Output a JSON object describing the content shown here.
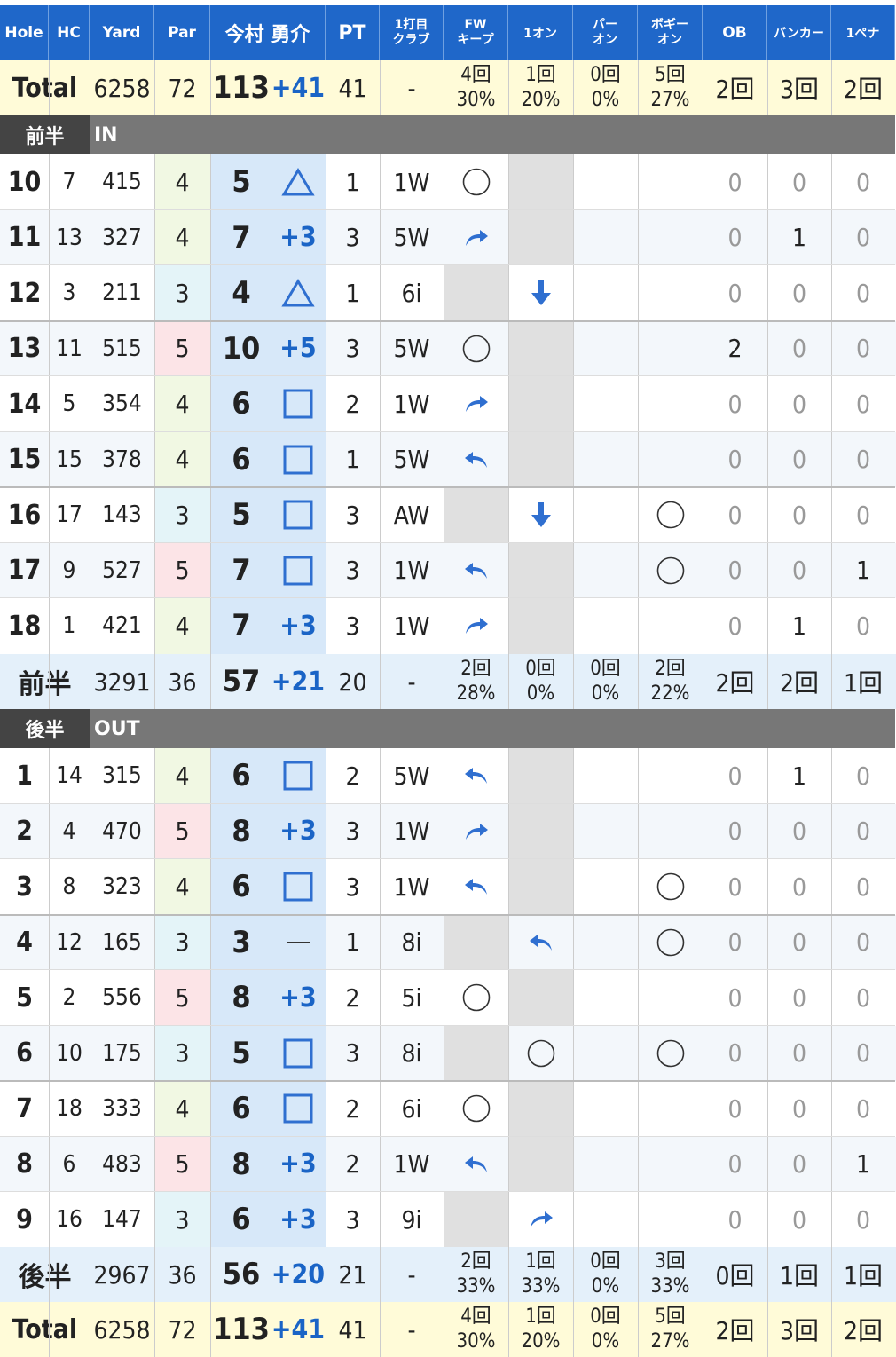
{
  "headers": {
    "hole": "Hole",
    "hc": "HC",
    "yard": "Yard",
    "par": "Par",
    "player": "今村 勇介",
    "pt": "PT",
    "club1": "1打目",
    "club2": "クラブ",
    "fw1": "FW",
    "fw2": "キープ",
    "oneon": "1オン",
    "paron1": "パー",
    "paron2": "オン",
    "bogey1": "ボギー",
    "bogey2": "オン",
    "ob": "OB",
    "bunker": "バンカー",
    "penalty": "1ペナ"
  },
  "sections": {
    "front_label": "前半",
    "front_course": "IN",
    "back_label": "後半",
    "back_course": "OUT"
  },
  "colors": {
    "header_bg": "#1f67c9",
    "score_bg": "#d7e8f9",
    "total_bg": "#fffbd8",
    "subtotal_bg": "#e4f0fa",
    "section_bg": "#777777",
    "par3": "#e4f4f8",
    "par4": "#f1f8e3",
    "par5": "#fce4e7",
    "accent_blue": "#1a64c6",
    "shaded": "#e0e0e0"
  },
  "total_top": {
    "label": "Total",
    "yard": "6258",
    "par": "72",
    "score": "113",
    "rel": "+41",
    "pt": "41",
    "club": "-",
    "fw": [
      "4回",
      "30%"
    ],
    "oneon": [
      "1回",
      "20%"
    ],
    "paron": [
      "0回",
      "0%"
    ],
    "bogey": [
      "5回",
      "27%"
    ],
    "ob": "2回",
    "bunker": "3回",
    "penalty": "2回"
  },
  "front": [
    {
      "hole": "10",
      "hc": "7",
      "yard": "415",
      "par": "4",
      "score": "5",
      "rel": "△",
      "relkind": "triangle",
      "pt": "1",
      "club": "1W",
      "fw": "circle",
      "oneon": "shade",
      "paron": "",
      "bogey": "",
      "ob": "0",
      "bunker": "0",
      "penalty": "0"
    },
    {
      "hole": "11",
      "hc": "13",
      "yard": "327",
      "par": "4",
      "score": "7",
      "rel": "+3",
      "relkind": "text",
      "pt": "3",
      "club": "5W",
      "fw": "right-arrow-icon",
      "oneon": "shade",
      "paron": "",
      "bogey": "",
      "ob": "0",
      "bunker": "1",
      "penalty": "0"
    },
    {
      "hole": "12",
      "hc": "3",
      "yard": "211",
      "par": "3",
      "score": "4",
      "rel": "△",
      "relkind": "triangle",
      "pt": "1",
      "club": "6i",
      "fw": "shade",
      "oneon": "down-arrow-icon",
      "paron": "",
      "bogey": "",
      "ob": "0",
      "bunker": "0",
      "penalty": "0"
    },
    {
      "hole": "13",
      "hc": "11",
      "yard": "515",
      "par": "5",
      "score": "10",
      "rel": "+5",
      "relkind": "text",
      "pt": "3",
      "club": "5W",
      "fw": "circle",
      "oneon": "shade",
      "paron": "",
      "bogey": "",
      "ob": "2",
      "bunker": "0",
      "penalty": "0"
    },
    {
      "hole": "14",
      "hc": "5",
      "yard": "354",
      "par": "4",
      "score": "6",
      "rel": "□",
      "relkind": "square",
      "pt": "2",
      "club": "1W",
      "fw": "right-arrow-icon",
      "oneon": "shade",
      "paron": "",
      "bogey": "",
      "ob": "0",
      "bunker": "0",
      "penalty": "0"
    },
    {
      "hole": "15",
      "hc": "15",
      "yard": "378",
      "par": "4",
      "score": "6",
      "rel": "□",
      "relkind": "square",
      "pt": "1",
      "club": "5W",
      "fw": "left-arrow-icon",
      "oneon": "shade",
      "paron": "",
      "bogey": "",
      "ob": "0",
      "bunker": "0",
      "penalty": "0"
    },
    {
      "hole": "16",
      "hc": "17",
      "yard": "143",
      "par": "3",
      "score": "5",
      "rel": "□",
      "relkind": "square",
      "pt": "3",
      "club": "AW",
      "fw": "shade",
      "oneon": "down-arrow-icon",
      "paron": "",
      "bogey": "circle",
      "ob": "0",
      "bunker": "0",
      "penalty": "0"
    },
    {
      "hole": "17",
      "hc": "9",
      "yard": "527",
      "par": "5",
      "score": "7",
      "rel": "□",
      "relkind": "square",
      "pt": "3",
      "club": "1W",
      "fw": "left-arrow-icon",
      "oneon": "shade",
      "paron": "",
      "bogey": "circle",
      "ob": "0",
      "bunker": "0",
      "penalty": "1"
    },
    {
      "hole": "18",
      "hc": "1",
      "yard": "421",
      "par": "4",
      "score": "7",
      "rel": "+3",
      "relkind": "text",
      "pt": "3",
      "club": "1W",
      "fw": "right-arrow-icon",
      "oneon": "shade",
      "paron": "",
      "bogey": "",
      "ob": "0",
      "bunker": "1",
      "penalty": "0"
    }
  ],
  "front_total": {
    "label": "前半",
    "yard": "3291",
    "par": "36",
    "score": "57",
    "rel": "+21",
    "pt": "20",
    "club": "-",
    "fw": [
      "2回",
      "28%"
    ],
    "oneon": [
      "0回",
      "0%"
    ],
    "paron": [
      "0回",
      "0%"
    ],
    "bogey": [
      "2回",
      "22%"
    ],
    "ob": "2回",
    "bunker": "2回",
    "penalty": "1回"
  },
  "back": [
    {
      "hole": "1",
      "hc": "14",
      "yard": "315",
      "par": "4",
      "score": "6",
      "rel": "□",
      "relkind": "square",
      "pt": "2",
      "club": "5W",
      "fw": "left-arrow-icon",
      "oneon": "shade",
      "paron": "",
      "bogey": "",
      "ob": "0",
      "bunker": "1",
      "penalty": "0"
    },
    {
      "hole": "2",
      "hc": "4",
      "yard": "470",
      "par": "5",
      "score": "8",
      "rel": "+3",
      "relkind": "text",
      "pt": "3",
      "club": "1W",
      "fw": "right-arrow-icon",
      "oneon": "shade",
      "paron": "",
      "bogey": "",
      "ob": "0",
      "bunker": "0",
      "penalty": "0"
    },
    {
      "hole": "3",
      "hc": "8",
      "yard": "323",
      "par": "4",
      "score": "6",
      "rel": "□",
      "relkind": "square",
      "pt": "3",
      "club": "1W",
      "fw": "left-arrow-icon",
      "oneon": "shade",
      "paron": "",
      "bogey": "circle",
      "ob": "0",
      "bunker": "0",
      "penalty": "0"
    },
    {
      "hole": "4",
      "hc": "12",
      "yard": "165",
      "par": "3",
      "score": "3",
      "rel": "—",
      "relkind": "dash",
      "pt": "1",
      "club": "8i",
      "fw": "shade",
      "oneon": "left-arrow-icon",
      "paron": "",
      "bogey": "circle",
      "ob": "0",
      "bunker": "0",
      "penalty": "0"
    },
    {
      "hole": "5",
      "hc": "2",
      "yard": "556",
      "par": "5",
      "score": "8",
      "rel": "+3",
      "relkind": "text",
      "pt": "2",
      "club": "5i",
      "fw": "circle",
      "oneon": "shade",
      "paron": "",
      "bogey": "",
      "ob": "0",
      "bunker": "0",
      "penalty": "0"
    },
    {
      "hole": "6",
      "hc": "10",
      "yard": "175",
      "par": "3",
      "score": "5",
      "rel": "□",
      "relkind": "square",
      "pt": "3",
      "club": "8i",
      "fw": "shade",
      "oneon": "circle",
      "paron": "",
      "bogey": "circle",
      "ob": "0",
      "bunker": "0",
      "penalty": "0"
    },
    {
      "hole": "7",
      "hc": "18",
      "yard": "333",
      "par": "4",
      "score": "6",
      "rel": "□",
      "relkind": "square",
      "pt": "2",
      "club": "6i",
      "fw": "circle",
      "oneon": "shade",
      "paron": "",
      "bogey": "",
      "ob": "0",
      "bunker": "0",
      "penalty": "0"
    },
    {
      "hole": "8",
      "hc": "6",
      "yard": "483",
      "par": "5",
      "score": "8",
      "rel": "+3",
      "relkind": "text",
      "pt": "2",
      "club": "1W",
      "fw": "left-arrow-icon",
      "oneon": "shade",
      "paron": "",
      "bogey": "",
      "ob": "0",
      "bunker": "0",
      "penalty": "1"
    },
    {
      "hole": "9",
      "hc": "16",
      "yard": "147",
      "par": "3",
      "score": "6",
      "rel": "+3",
      "relkind": "text",
      "pt": "3",
      "club": "9i",
      "fw": "shade",
      "oneon": "right-arrow-icon",
      "paron": "",
      "bogey": "",
      "ob": "0",
      "bunker": "0",
      "penalty": "0"
    }
  ],
  "back_total": {
    "label": "後半",
    "yard": "2967",
    "par": "36",
    "score": "56",
    "rel": "+20",
    "pt": "21",
    "club": "-",
    "fw": [
      "2回",
      "33%"
    ],
    "oneon": [
      "1回",
      "33%"
    ],
    "paron": [
      "0回",
      "0%"
    ],
    "bogey": [
      "3回",
      "33%"
    ],
    "ob": "0回",
    "bunker": "1回",
    "penalty": "1回"
  },
  "total_bottom": {
    "label": "Total",
    "yard": "6258",
    "par": "72",
    "score": "113",
    "rel": "+41",
    "pt": "41",
    "club": "-",
    "fw": [
      "4回",
      "30%"
    ],
    "oneon": [
      "1回",
      "20%"
    ],
    "paron": [
      "0回",
      "0%"
    ],
    "bogey": [
      "5回",
      "27%"
    ],
    "ob": "2回",
    "bunker": "3回",
    "penalty": "2回"
  }
}
